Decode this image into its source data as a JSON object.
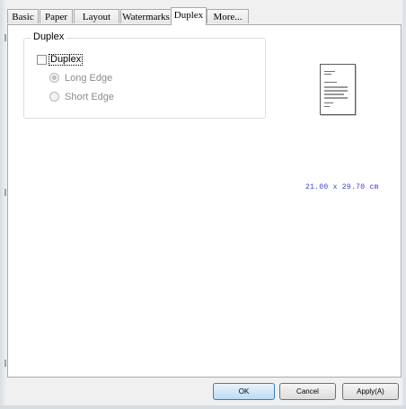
{
  "tabs": [
    "Basic",
    "Paper",
    "Layout",
    "Watermarks",
    "Duplex",
    "More..."
  ],
  "active_tab": "Duplex",
  "duplex_group": {
    "title": "Duplex",
    "checkbox_label": "Duplex",
    "checkbox_checked": false,
    "options": [
      "Long Edge",
      "Short Edge"
    ],
    "selected_option": "Long Edge",
    "options_enabled": false
  },
  "paper_size_text": "21.00 x 29.70 cm",
  "buttons": {
    "ok": "OK",
    "cancel": "Cancel",
    "apply": "Apply(A)"
  }
}
